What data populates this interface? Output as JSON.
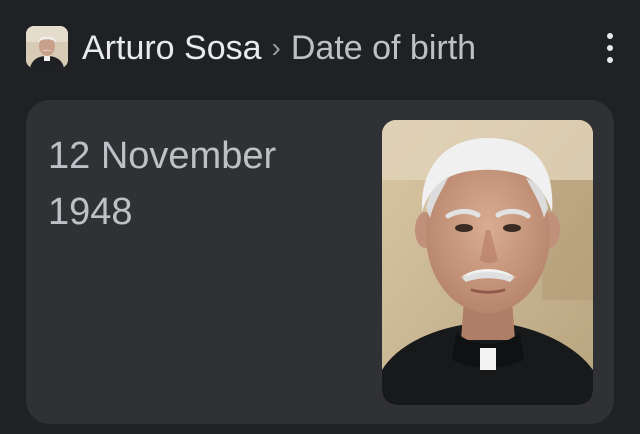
{
  "header": {
    "entity_name": "Arturo Sosa",
    "separator": "›",
    "attribute": "Date of birth",
    "thumbnail_icon": "person-portrait-thumbnail",
    "menu_icon": "more-vert-icon"
  },
  "card": {
    "answer_line1": "12 November",
    "answer_line2": "1948",
    "image_icon": "person-portrait-photo"
  },
  "colors": {
    "background": "#202124",
    "card": "#303134",
    "primary_text": "#e8eaed",
    "secondary_text": "#bdc1c6"
  }
}
